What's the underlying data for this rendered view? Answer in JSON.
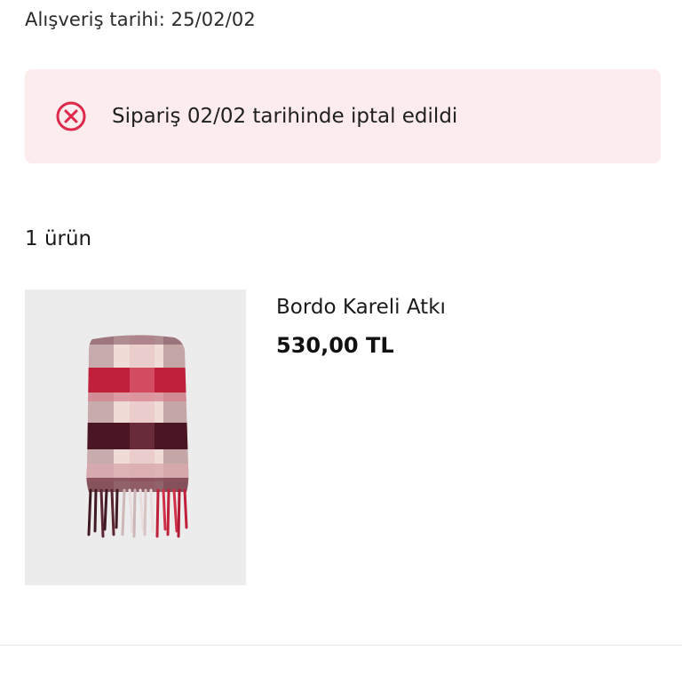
{
  "order": {
    "purchase_date_text": "Alışveriş tarihi: 25/02/02"
  },
  "cancel_banner": {
    "message": "Sipariş 02/02 tarihinde iptal edildi",
    "icon": "close-circle-icon",
    "background_color": "#fdeced",
    "icon_color": "#e0284a"
  },
  "items_section": {
    "count_text": "1 ürün"
  },
  "product": {
    "name": "Bordo Kareli Atkı",
    "price": "530,00 TL",
    "image_icon": "plaid-scarf-image"
  }
}
